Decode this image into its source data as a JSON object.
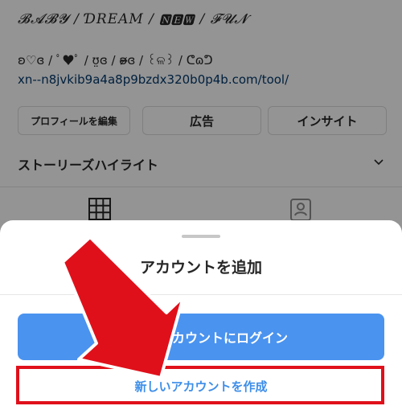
{
  "profile": {
    "bio_line1": "𝓑𝓐𝓑𝓨 / ƊREAM / 🅽🅴🆆 / 𝓕𝓤𝓝",
    "bio_line2": "ʚ♡ɞ / ﾟ♥ﾟ / ʊ̤ɞ / ʚ̴̶̷ɞ / ꒰ଳ꒱ / ᕦɷᕤ",
    "link": "xn--n8jvkib9a4a8p9bzdx320b0p4b.com/tool/",
    "buttons": {
      "edit": "プロフィールを編集",
      "ad": "広告",
      "insight": "インサイト"
    },
    "highlights_label": "ストーリーズハイライト"
  },
  "sheet": {
    "title": "アカウントを追加",
    "login_button": "アカウントにログイン",
    "create_button": "新しいアカウントを作成"
  },
  "colors": {
    "accent": "#4a93ef",
    "link": "#00376b",
    "annotation": "#e0101a"
  },
  "icons": {
    "grid": "grid-icon",
    "tagged": "tagged-icon",
    "chevron": "chevron-down-icon",
    "arrow": "red-arrow-annotation"
  }
}
